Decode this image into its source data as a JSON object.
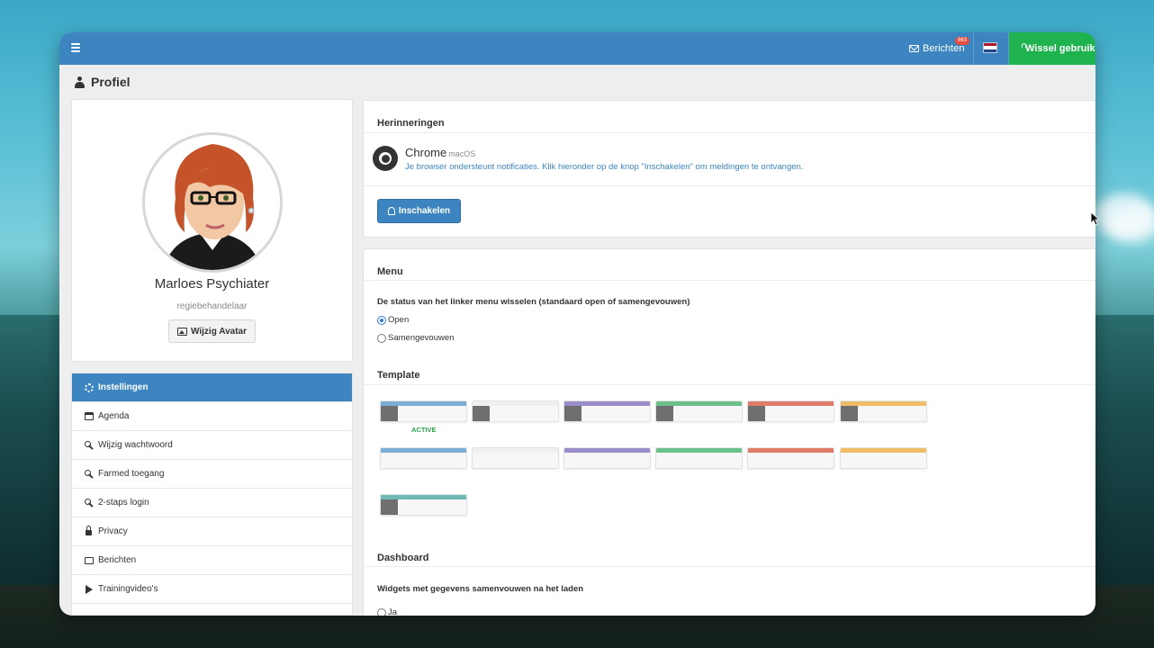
{
  "topbar": {
    "messages_label": "Berichten",
    "messages_badge": "663",
    "switch_user_label": "Wissel gebruiker",
    "flag_colors": [
      "#ae1c28",
      "#ffffff",
      "#21468b"
    ],
    "bar_color": "#3c85c0",
    "switch_color": "#1fb34f"
  },
  "page": {
    "title": "Profiel"
  },
  "profile": {
    "name": "Marloes Psychiater",
    "role": "regiebehandelaar",
    "avatar_button": "Wijzig Avatar"
  },
  "sidebar": {
    "items": [
      {
        "label": "Instellingen",
        "icon": "cogs-icon"
      },
      {
        "label": "Agenda",
        "icon": "calendar-icon"
      },
      {
        "label": "Wijzig wachtwoord",
        "icon": "key-icon"
      },
      {
        "label": "Farmed toegang",
        "icon": "key-icon"
      },
      {
        "label": "2-staps login",
        "icon": "key-icon"
      },
      {
        "label": "Privacy",
        "icon": "lock-icon"
      },
      {
        "label": "Berichten",
        "icon": "envelope-icon"
      },
      {
        "label": "Trainingvideo's",
        "icon": "play-icon"
      }
    ]
  },
  "reminders": {
    "title": "Herinneringen",
    "browser": "Chrome",
    "os": "macOS",
    "note": "Je browser ondersteunt notificaties. Klik hieronder op de knop \"Inschakelen\" om meldingen te ontvangen.",
    "button": "Inschakelen"
  },
  "menu": {
    "title": "Menu",
    "question": "De status van het linker menu wisselen (standaard open of samengevouwen)",
    "options": [
      "Open",
      "Samengevouwen"
    ],
    "selected": "Open"
  },
  "template": {
    "title": "Template",
    "active_label": "ACTIVE",
    "colors": [
      "#7aaed4",
      "#f0f0f0",
      "#9b8ccc",
      "#6cc08a",
      "#e07b6a",
      "#f0bc68",
      "#6fb9b4"
    ]
  },
  "dashboard": {
    "title": "Dashboard",
    "question": "Widgets met gegevens samenvouwen na het laden",
    "option_visible": "Ja"
  }
}
